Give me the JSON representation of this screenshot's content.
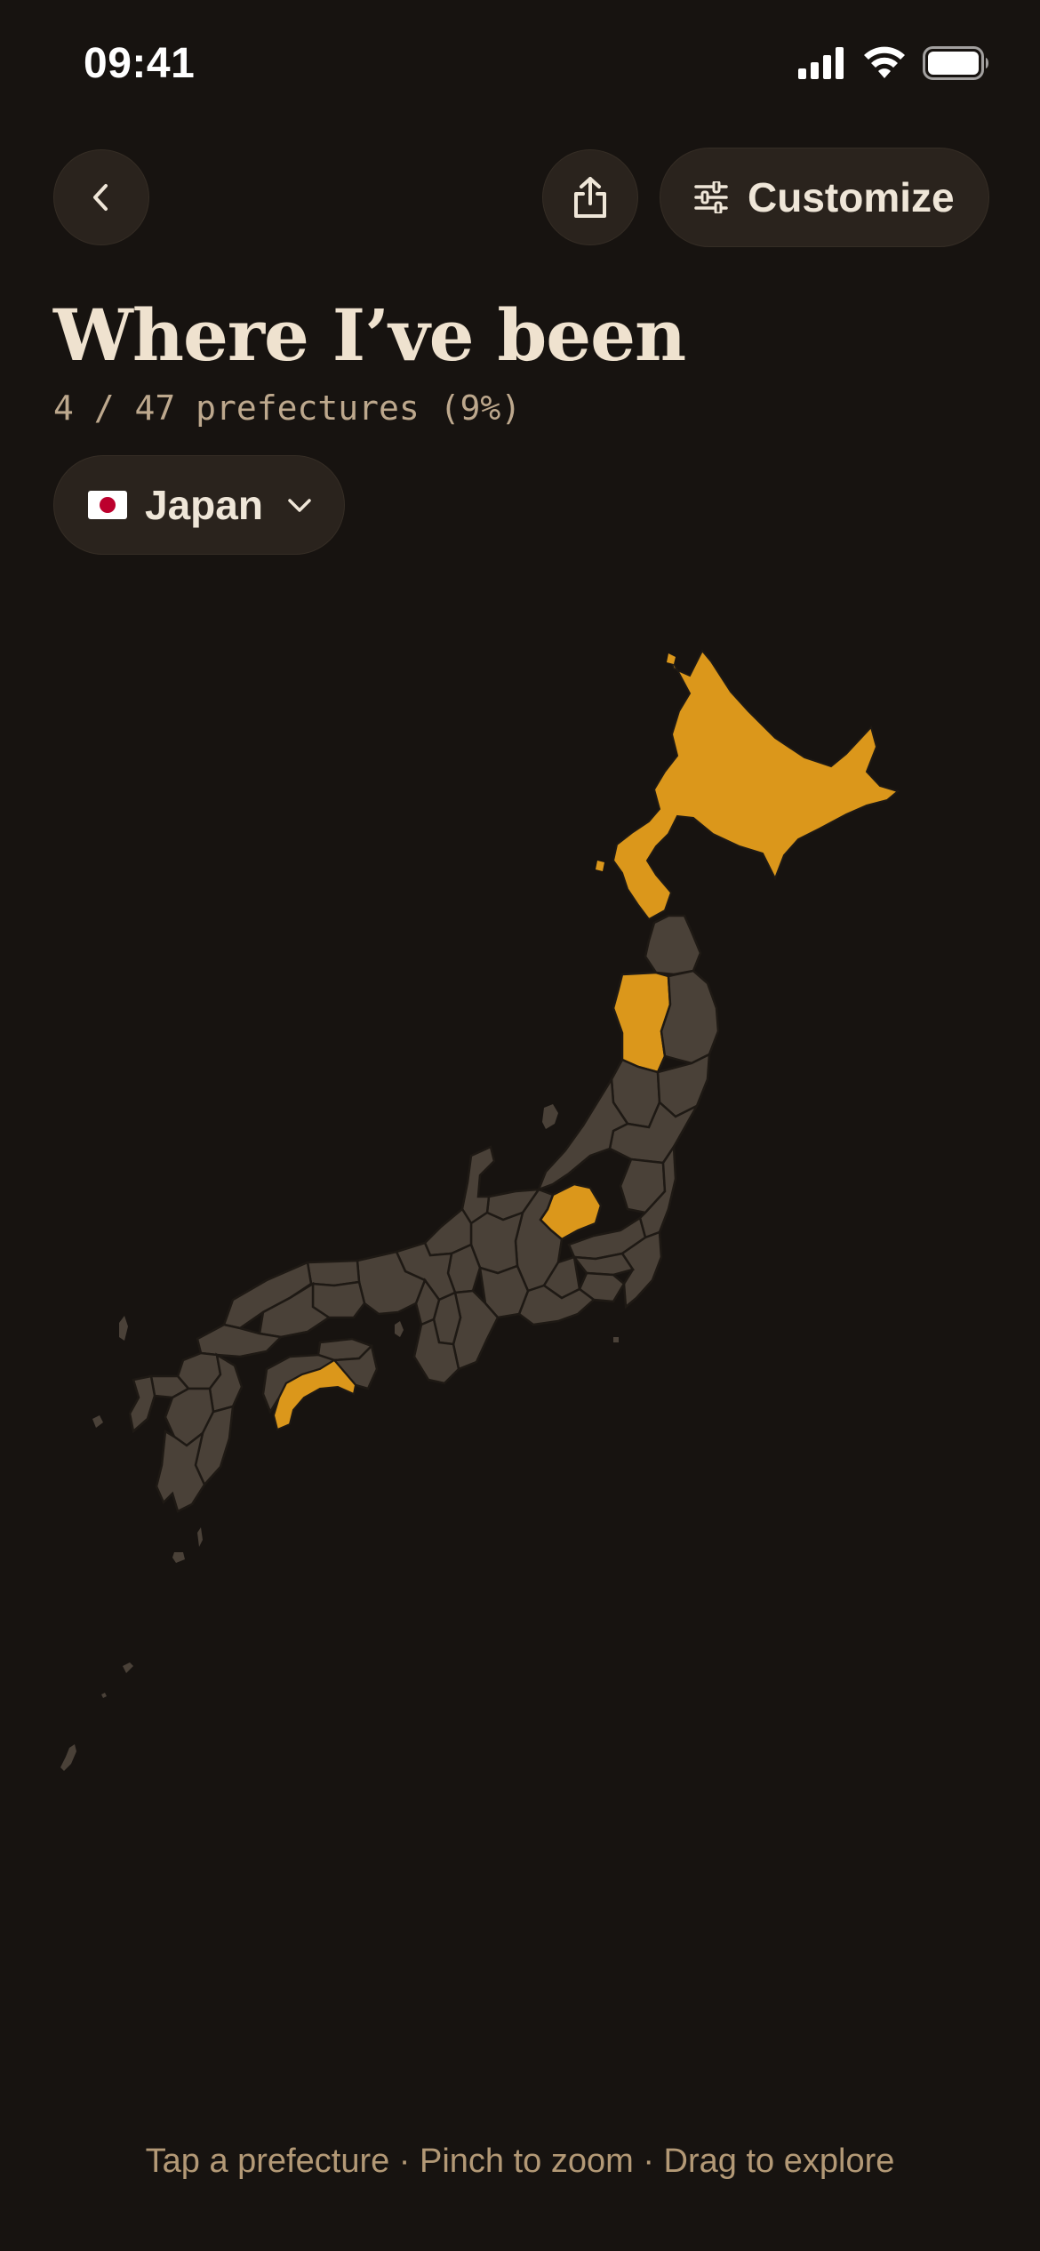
{
  "status_bar": {
    "time": "09:41"
  },
  "header": {
    "back_icon": "chevron-left-icon",
    "share_icon": "share-icon",
    "customize_icon": "sliders-icon",
    "customize_label": "Customize"
  },
  "title": "Where I’ve been",
  "subtitle": "4 / 47 prefectures (9%)",
  "country": {
    "flag_icon": "japan-flag-icon",
    "name": "Japan",
    "chevron_icon": "chevron-down-icon"
  },
  "map": {
    "visited_count": 4,
    "total_count": 47,
    "visited_color": "#DB971B",
    "unvisited_color": "#4A4138",
    "border_color": "#1E1914"
  },
  "hint": "Tap a prefecture · Pinch to zoom · Drag to explore"
}
